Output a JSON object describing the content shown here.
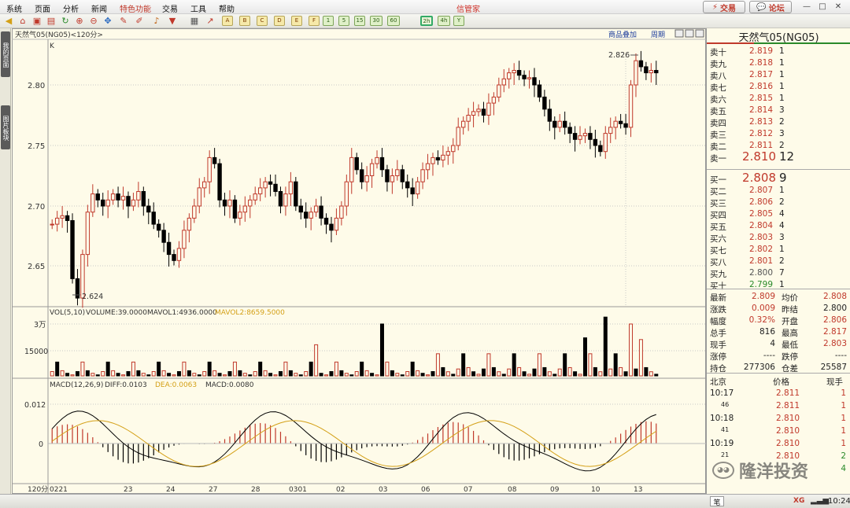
{
  "menu": [
    "系统",
    "页面",
    "分析",
    "新闻",
    "特色功能",
    "交易",
    "工具",
    "帮助"
  ],
  "app_title": "信管家",
  "top_buttons": {
    "trade": "交易",
    "forum": "论坛"
  },
  "icons": {
    "trade": "lightning-icon",
    "forum": "speech-bubble-icon"
  },
  "toolbar": {
    "period_buttons": [
      "1",
      "5",
      "15",
      "30",
      "60",
      "2h",
      "4h",
      "Y"
    ],
    "selected_period": "2h"
  },
  "left_rail": {
    "tabs": [
      "我的页面",
      "图片板块"
    ]
  },
  "chart": {
    "title": "天然气05(NG05)<120分>",
    "k_label": "K",
    "top_links": [
      "商品叠加",
      "周期"
    ],
    "price_ticks": [
      "2.80",
      "2.75",
      "2.70",
      "2.65"
    ],
    "high_label": "2.826",
    "low_label": "2.624",
    "vol_header": {
      "a": "VOL(5,10)",
      "b": "VOLUME:39.0000",
      "c": "MAVOL1:4936.0000",
      "d": "MAVOL2:8659.5000"
    },
    "vol_ticks": [
      "3万",
      "15000"
    ],
    "macd_header": {
      "a": "MACD(12,26,9)",
      "b": "DIFF:0.0103",
      "c": "DEA:0.0063",
      "d": "MACD:0.0080"
    },
    "macd_ticks": [
      "0.012",
      "0"
    ],
    "period_label": "120分",
    "date_labels": [
      "0221",
      "23",
      "24",
      "27",
      "28",
      "0301",
      "02",
      "03",
      "06",
      "07",
      "08",
      "09",
      "10",
      "13"
    ],
    "colors": {
      "up": "#c0392b",
      "down": "#000000",
      "diff": "#000000",
      "dea": "#d4a017"
    }
  },
  "chart_data": {
    "type": "candlestick",
    "price_range": [
      2.62,
      2.83
    ],
    "high": 2.826,
    "low": 2.624
  },
  "quote": {
    "name": "天然气05(NG05)",
    "asks": [
      {
        "label": "卖十",
        "price": "2.819",
        "vol": "1"
      },
      {
        "label": "卖九",
        "price": "2.818",
        "vol": "1"
      },
      {
        "label": "卖八",
        "price": "2.817",
        "vol": "1"
      },
      {
        "label": "卖七",
        "price": "2.816",
        "vol": "1"
      },
      {
        "label": "卖六",
        "price": "2.815",
        "vol": "1"
      },
      {
        "label": "卖五",
        "price": "2.814",
        "vol": "3"
      },
      {
        "label": "卖四",
        "price": "2.813",
        "vol": "2"
      },
      {
        "label": "卖三",
        "price": "2.812",
        "vol": "3"
      },
      {
        "label": "卖二",
        "price": "2.811",
        "vol": "2"
      },
      {
        "label": "卖一",
        "price": "2.810",
        "vol": "12"
      }
    ],
    "bids": [
      {
        "label": "买一",
        "price": "2.808",
        "vol": "9"
      },
      {
        "label": "买二",
        "price": "2.807",
        "vol": "1"
      },
      {
        "label": "买三",
        "price": "2.806",
        "vol": "2"
      },
      {
        "label": "买四",
        "price": "2.805",
        "vol": "4"
      },
      {
        "label": "买五",
        "price": "2.804",
        "vol": "4"
      },
      {
        "label": "买六",
        "price": "2.803",
        "vol": "3"
      },
      {
        "label": "买七",
        "price": "2.802",
        "vol": "1"
      },
      {
        "label": "买八",
        "price": "2.801",
        "vol": "2"
      },
      {
        "label": "买九",
        "price": "2.800",
        "vol": "7"
      },
      {
        "label": "买十",
        "price": "2.799",
        "vol": "1"
      }
    ],
    "stats": [
      {
        "l1": "最新",
        "v1": "2.809",
        "l2": "均价",
        "v2": "2.808"
      },
      {
        "l1": "涨跌",
        "v1": "0.009",
        "l2": "昨结",
        "v2": "2.800"
      },
      {
        "l1": "幅度",
        "v1": "0.32%",
        "l2": "开盘",
        "v2": "2.806"
      },
      {
        "l1": "总手",
        "v1": "816",
        "l2": "最高",
        "v2": "2.817"
      },
      {
        "l1": "现手",
        "v1": "4",
        "l2": "最低",
        "v2": "2.803"
      },
      {
        "l1": "涨停",
        "v1": "----",
        "l2": "跌停",
        "v2": "----"
      },
      {
        "l1": "持仓",
        "v1": "277306",
        "l2": "仓差",
        "v2": "25587"
      }
    ],
    "trades_header": {
      "a": "北京",
      "b": "价格",
      "c": "现手"
    },
    "trades": [
      {
        "time": "10:17",
        "price": "2.811",
        "vol": "1"
      },
      {
        "time": "46",
        "price": "2.811",
        "vol": "1"
      },
      {
        "time": "10:18",
        "price": "2.810",
        "vol": "1"
      },
      {
        "time": "41",
        "price": "2.810",
        "vol": "1"
      },
      {
        "time": "10:19",
        "price": "2.810",
        "vol": "1"
      },
      {
        "time": "21",
        "price": "2.810",
        "vol": "2"
      },
      {
        "time": "",
        "price": "",
        "vol": "4"
      }
    ]
  },
  "status": {
    "clock": "10:24",
    "brand": "XG",
    "tab": "笔"
  },
  "watermark": "隆洋投资"
}
